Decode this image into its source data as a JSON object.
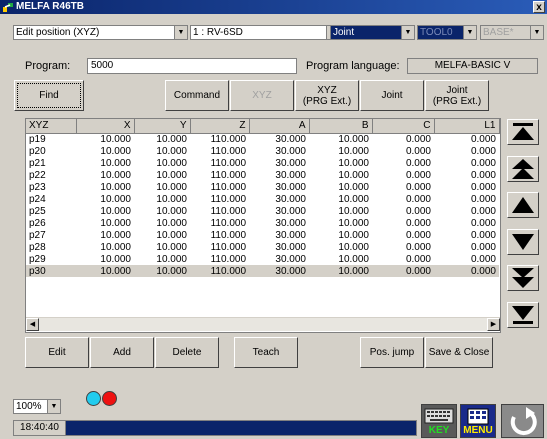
{
  "window": {
    "title": "MELFA R46TB",
    "close_label": "x"
  },
  "toolbar": {
    "mode": "Edit position (XYZ)",
    "robot": "1 : RV-6SD",
    "coord": "Joint",
    "tool": "TOOL0",
    "base": "BASE*"
  },
  "program": {
    "label": "Program:",
    "value": "5000",
    "lang_label": "Program language:",
    "lang_value": "MELFA-BASIC V"
  },
  "buttons": {
    "find": "Find",
    "command": "Command",
    "xyz": "XYZ",
    "xyz_prg": "XYZ\n(PRG Ext.)",
    "joint": "Joint",
    "joint_prg": "Joint\n(PRG Ext.)",
    "edit": "Edit",
    "add": "Add",
    "delete": "Delete",
    "teach": "Teach",
    "pos_jump": "Pos. jump",
    "save_close": "Save & Close"
  },
  "table": {
    "columns": [
      "XYZ",
      "X",
      "Y",
      "Z",
      "A",
      "B",
      "C",
      "L1"
    ],
    "rows": [
      [
        "p19",
        "10.000",
        "10.000",
        "110.000",
        "30.000",
        "10.000",
        "0.000",
        "0.000"
      ],
      [
        "p20",
        "10.000",
        "10.000",
        "110.000",
        "30.000",
        "10.000",
        "0.000",
        "0.000"
      ],
      [
        "p21",
        "10.000",
        "10.000",
        "110.000",
        "30.000",
        "10.000",
        "0.000",
        "0.000"
      ],
      [
        "p22",
        "10.000",
        "10.000",
        "110.000",
        "30.000",
        "10.000",
        "0.000",
        "0.000"
      ],
      [
        "p23",
        "10.000",
        "10.000",
        "110.000",
        "30.000",
        "10.000",
        "0.000",
        "0.000"
      ],
      [
        "p24",
        "10.000",
        "10.000",
        "110.000",
        "30.000",
        "10.000",
        "0.000",
        "0.000"
      ],
      [
        "p25",
        "10.000",
        "10.000",
        "110.000",
        "30.000",
        "10.000",
        "0.000",
        "0.000"
      ],
      [
        "p26",
        "10.000",
        "10.000",
        "110.000",
        "30.000",
        "10.000",
        "0.000",
        "0.000"
      ],
      [
        "p27",
        "10.000",
        "10.000",
        "110.000",
        "30.000",
        "10.000",
        "0.000",
        "0.000"
      ],
      [
        "p28",
        "10.000",
        "10.000",
        "110.000",
        "30.000",
        "10.000",
        "0.000",
        "0.000"
      ],
      [
        "p29",
        "10.000",
        "10.000",
        "110.000",
        "30.000",
        "10.000",
        "0.000",
        "0.000"
      ],
      [
        "p30",
        "10.000",
        "10.000",
        "110.000",
        "30.000",
        "10.000",
        "0.000",
        "0.000"
      ]
    ],
    "selected_row": 11
  },
  "footer": {
    "zoom": "100%",
    "clock": "18:40:40",
    "key_label": "KEY",
    "menu_label": "MENU"
  },
  "colors": {
    "title_bar": "#0a246a",
    "status_dot_1": "#22ccee",
    "status_dot_2": "#ee1111"
  }
}
